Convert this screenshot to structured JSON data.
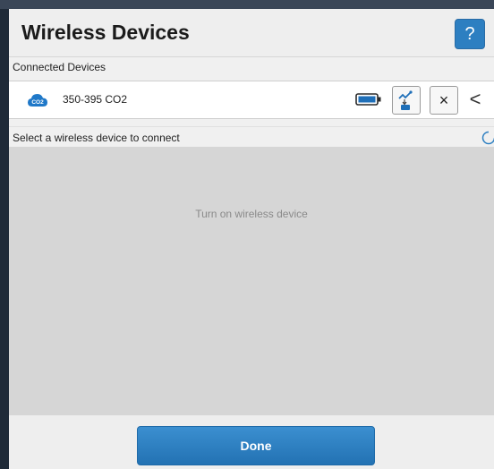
{
  "dialog": {
    "title": "Wireless Devices",
    "help_label": "?"
  },
  "connected": {
    "section_label": "Connected Devices",
    "device": {
      "icon_label": "CO2",
      "name": "350-395  CO2",
      "battery_icon": "battery-icon",
      "graph_icon": "graph-transfer-icon",
      "close_label": "×",
      "back_label": "<"
    }
  },
  "available": {
    "section_label": "Select a wireless device to connect",
    "hint": "Turn on wireless device"
  },
  "footer": {
    "done_label": "Done"
  },
  "colors": {
    "accent": "#2d7fc1",
    "background": "#f0f0f0",
    "list_area": "#d6d6d6"
  }
}
